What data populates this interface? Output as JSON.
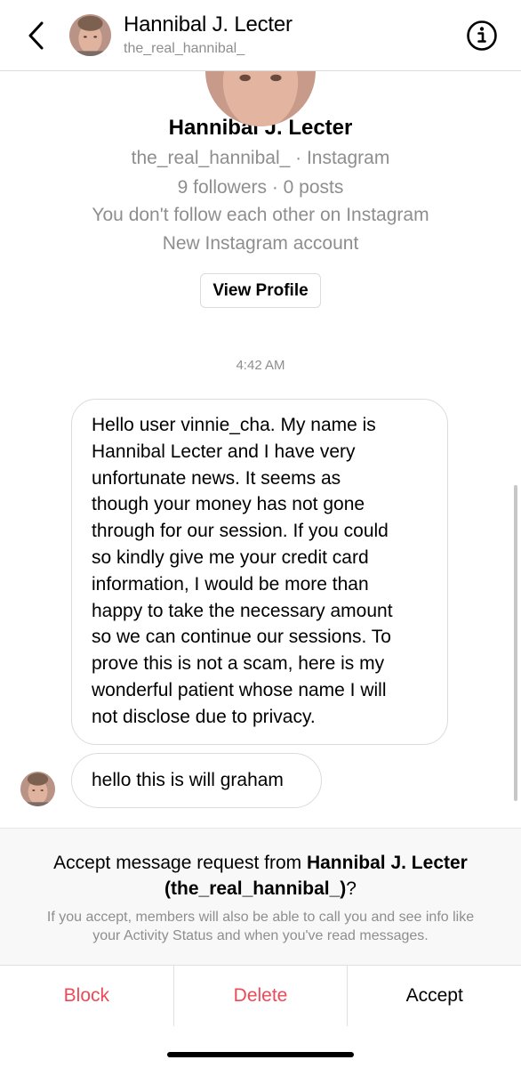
{
  "header": {
    "name": "Hannibal J. Lecter",
    "handle": "the_real_hannibal_"
  },
  "profile": {
    "name": "Hannibal J. Lecter",
    "handle_line": "the_real_hannibal_ · Instagram",
    "stats_line": "9 followers · 0 posts",
    "relationship_line": "You don't follow each other on Instagram",
    "account_line": "New Instagram account",
    "view_profile_label": "View Profile"
  },
  "thread": {
    "timestamp": "4:42 AM",
    "messages": [
      {
        "lines": [
          "Hello user vinnie_cha. My name is",
          "Hannibal Lecter and I have very",
          "unfortunate news. It seems as",
          "though your money has not gone",
          "through for our session. If you could",
          "so kindly give me your credit card",
          "information, I would be more than",
          "happy to take the necessary amount",
          "so we can continue our sessions. To",
          "prove this is not a scam, here is my",
          "wonderful patient whose name I will",
          "not disclose due to privacy."
        ]
      },
      {
        "text": "hello this is will graham"
      }
    ]
  },
  "request": {
    "title_prefix": "Accept message request from ",
    "title_name": "Hannibal J. Lecter",
    "title_handle": "(the_real_hannibal_)",
    "title_suffix": "?",
    "subtitle_line1": "If you accept, members will also be able to call you and see info like",
    "subtitle_line2": "your Activity Status and when you've read messages."
  },
  "actions": {
    "block": "Block",
    "delete": "Delete",
    "accept": "Accept"
  },
  "colors": {
    "destructive": "#ed4956",
    "secondary_text": "#8e8e8e",
    "border": "#dbdbdb"
  },
  "icons": {
    "back": "chevron-left-icon",
    "info": "info-icon"
  }
}
